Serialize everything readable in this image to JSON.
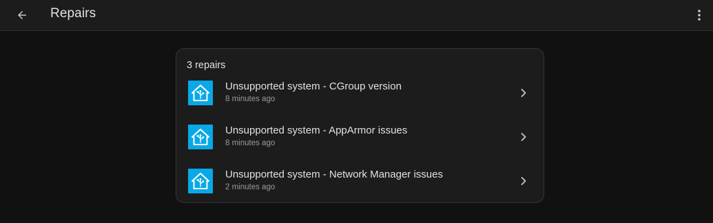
{
  "header": {
    "title": "Repairs",
    "back_icon": "arrow-left-icon",
    "menu_icon": "dots-vertical-icon"
  },
  "card": {
    "heading": "3 repairs",
    "items": [
      {
        "title": "Unsupported system - CGroup version",
        "time": "8 minutes ago",
        "icon": "home-assistant-logo-icon"
      },
      {
        "title": "Unsupported system - AppArmor issues",
        "time": "8 minutes ago",
        "icon": "home-assistant-logo-icon"
      },
      {
        "title": "Unsupported system - Network Manager issues",
        "time": "2 minutes ago",
        "icon": "home-assistant-logo-icon"
      }
    ]
  },
  "colors": {
    "background": "#111111",
    "toolbar": "#1c1c1c",
    "card": "#1c1c1c",
    "brand": "#0aa8e6",
    "text": "#e1e1e1",
    "secondary_text": "#9b9b9b"
  }
}
